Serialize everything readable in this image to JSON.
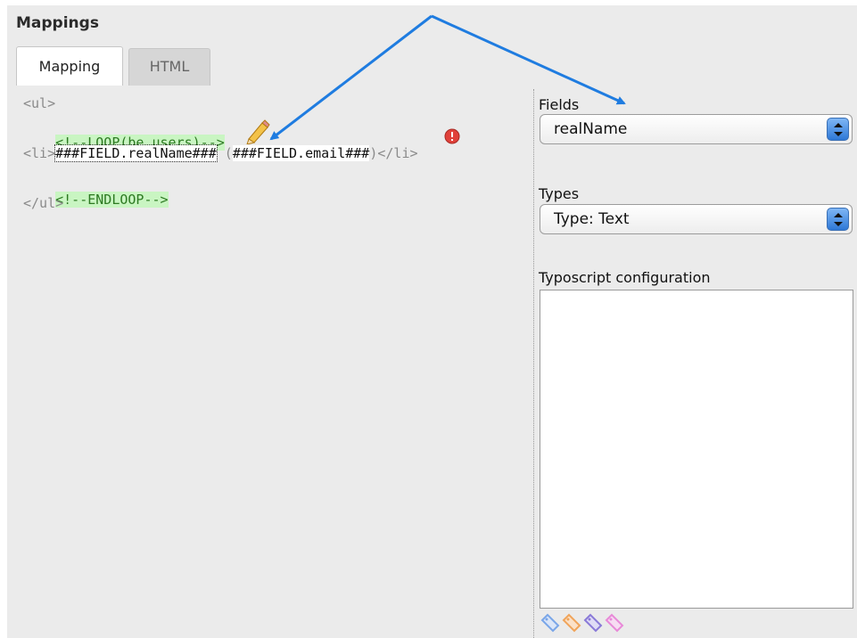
{
  "panel": {
    "title": "Mappings"
  },
  "tabs": [
    {
      "label": "Mapping"
    },
    {
      "label": "HTML"
    }
  ],
  "code": {
    "lines": [
      {
        "text": "<ul>"
      },
      {
        "text": "<!--LOOP(be_users)-->"
      },
      {
        "open": "<li>",
        "marker1": "###FIELD.realName###",
        "mid": " (",
        "marker2": "###FIELD.email###",
        "close": ")</li>"
      },
      {
        "text": "<!--ENDLOOP-->"
      },
      {
        "text": "</ul>"
      }
    ]
  },
  "fields": {
    "label": "Fields",
    "selected": "realName"
  },
  "types": {
    "label": "Types",
    "selected": "Type: Text"
  },
  "typoscript": {
    "label": "Typoscript configuration",
    "value": ""
  },
  "tag_icons": [
    {
      "name": "blue-tag-icon",
      "color": "#7aa6e8"
    },
    {
      "name": "orange-tag-icon",
      "color": "#f0a45a"
    },
    {
      "name": "purple-tag-icon",
      "color": "#8a7ad8"
    },
    {
      "name": "pink-tag-icon",
      "color": "#e889d8"
    }
  ],
  "colors": {
    "annotation_arrow": "#1f7ce0",
    "code_highlight": "#c9f5c2",
    "error_badge": "#e0413a"
  }
}
